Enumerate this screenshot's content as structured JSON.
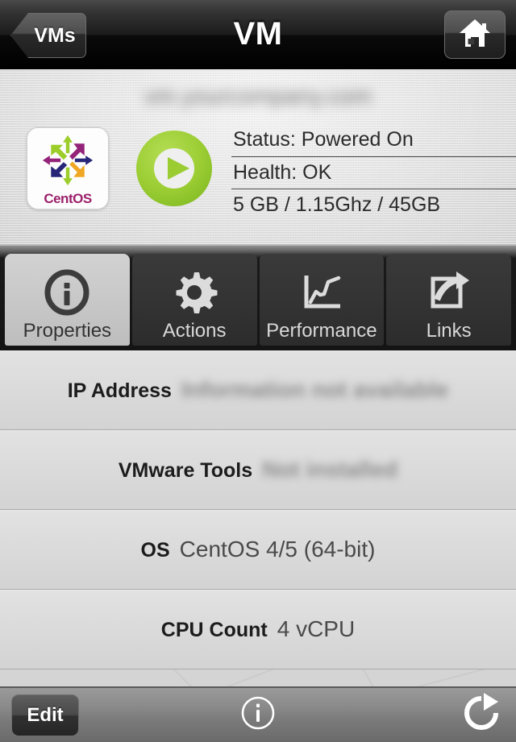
{
  "navbar": {
    "back_label": "VMs",
    "title": "VM",
    "home_icon": "home-icon"
  },
  "summary": {
    "vm_name": "vm.yourcompany.com",
    "vm_name_redacted": true,
    "os_logo_label": "CentOS",
    "power_state_icon": "play-icon",
    "power_color": "#9acd32",
    "status": "Status: Powered On",
    "health": "Health: OK",
    "resources": "5 GB / 1.15Ghz / 45GB"
  },
  "tabs": [
    {
      "label": "Properties",
      "icon": "info-circle-icon",
      "active": true
    },
    {
      "label": "Actions",
      "icon": "gear-icon",
      "active": false
    },
    {
      "label": "Performance",
      "icon": "line-chart-icon",
      "active": false
    },
    {
      "label": "Links",
      "icon": "external-link-icon",
      "active": false
    }
  ],
  "properties": [
    {
      "label": "IP Address",
      "value": "Information not available",
      "redacted": true
    },
    {
      "label": "VMware Tools",
      "value": "Not installed",
      "redacted": true
    },
    {
      "label": "OS",
      "value": "CentOS 4/5 (64-bit)",
      "redacted": false
    },
    {
      "label": "CPU Count",
      "value": "4 vCPU",
      "redacted": false
    }
  ],
  "toolbar": {
    "edit_label": "Edit",
    "info_icon": "info-circle-icon",
    "refresh_icon": "refresh-icon"
  },
  "colors": {
    "accent_green": "#9acd32",
    "navbar_bg": "#111111",
    "active_tab_bg": "#c6c6c6",
    "toolbar_bg": "#808080"
  }
}
